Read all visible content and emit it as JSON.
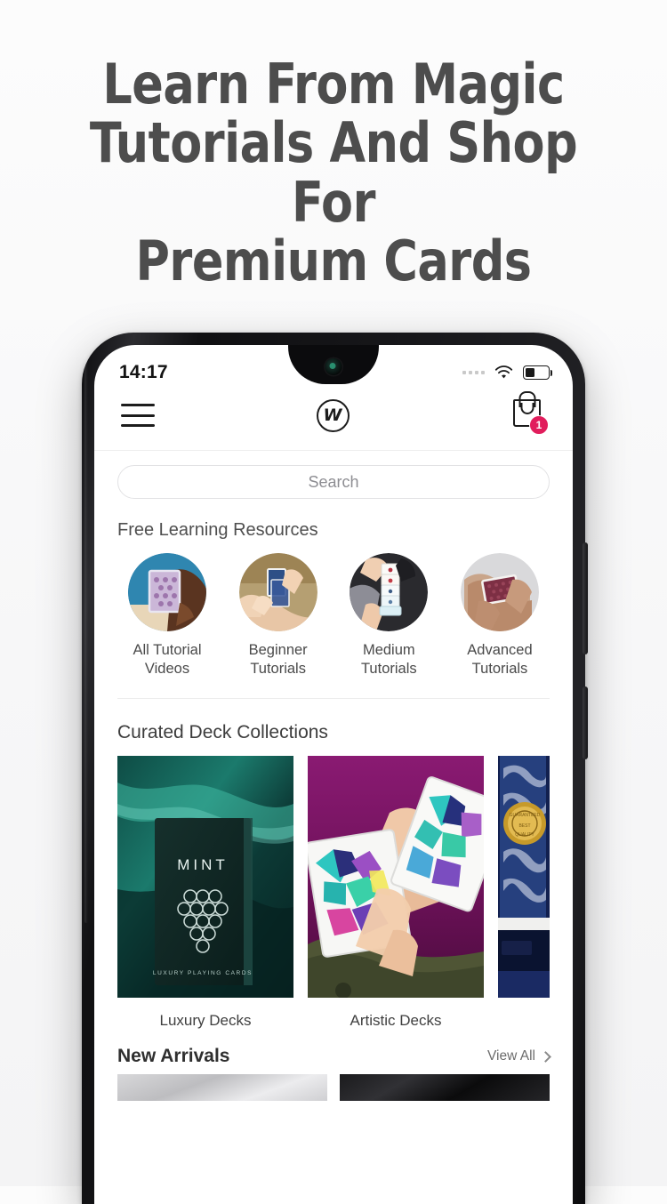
{
  "hero": {
    "headline_line1": "Learn From Magic",
    "headline_line2": "Tutorials And Shop For",
    "headline_line3": "Premium Cards"
  },
  "colors": {
    "badge": "#e11d5c",
    "heading": "#4d4d4d",
    "body_text": "#4a4a4a",
    "phone_bezel": "#141416"
  },
  "status_bar": {
    "time": "14:17",
    "signal_icon": "signal-dots-icon",
    "wifi_icon": "wifi-icon",
    "battery_icon": "battery-icon",
    "battery_level_percent": 42
  },
  "app_header": {
    "menu_icon": "hamburger-menu-icon",
    "logo_text": "W",
    "logo_icon": "brand-logo-icon",
    "cart_icon": "shopping-bag-icon",
    "cart_badge_count": "1"
  },
  "search": {
    "placeholder": "Search",
    "value": ""
  },
  "learning": {
    "title": "Free Learning Resources",
    "items": [
      {
        "label_line1": "All Tutorial",
        "label_line2": "Videos",
        "image": "hand-holding-purple-card-on-blue-fabric"
      },
      {
        "label_line1": "Beginner",
        "label_line2": "Tutorials",
        "image": "hands-springing-blue-deck"
      },
      {
        "label_line1": "Medium",
        "label_line2": "Tutorials",
        "image": "cards-cascading-between-hands"
      },
      {
        "label_line1": "Advanced",
        "label_line2": "Tutorials",
        "image": "hand-holding-red-deck"
      }
    ]
  },
  "collections": {
    "title": "Curated Deck Collections",
    "items": [
      {
        "label": "Luxury Decks",
        "image": "mint-black-deck-box-on-teal-marble",
        "box_brand": "MINT",
        "box_subtitle": "LUXURY PLAYING CARDS"
      },
      {
        "label": "Artistic Decks",
        "image": "hands-holding-geometric-art-decks-on-magenta"
      },
      {
        "label": "",
        "image": "classic-blue-deck-with-gold-seal"
      }
    ]
  },
  "new_arrivals": {
    "title": "New Arrivals",
    "view_all_label": "View All",
    "chevron_icon": "chevron-right-icon",
    "items": [
      {
        "image": "light-gray-product-photo"
      },
      {
        "image": "dark-black-product-photo"
      }
    ]
  }
}
